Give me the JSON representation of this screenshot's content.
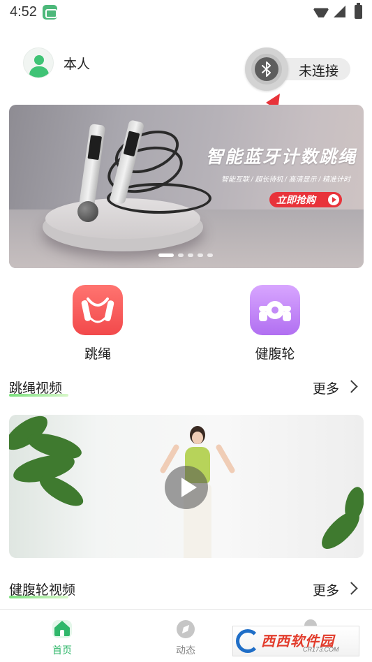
{
  "status_bar": {
    "time": "4:52",
    "icons": [
      "app-notification-icon",
      "wifi-icon",
      "cellular-signal-icon",
      "battery-charging-icon"
    ]
  },
  "header": {
    "user_name": "本人",
    "bluetooth_status": "未连接",
    "bluetooth_icon": "bluetooth-icon"
  },
  "banner": {
    "title": "智能蓝牙计数跳绳",
    "subtitle": "智能互联 / 超长待机 / 高清显示 / 精准计时",
    "cta_label": "立即抢购",
    "slide_count": 5,
    "active_slide": 1
  },
  "categories": [
    {
      "label": "跳绳",
      "icon": "jump-rope-icon",
      "color": "#f2494b"
    },
    {
      "label": "健腹轮",
      "icon": "ab-wheel-icon",
      "color": "#b16ff1"
    }
  ],
  "sections": [
    {
      "title": "跳绳视频",
      "more_label": "更多"
    },
    {
      "title": "健腹轮视频",
      "more_label": "更多"
    }
  ],
  "video": {
    "icon": "play-icon"
  },
  "bottom_nav": {
    "items": [
      {
        "label": "首页",
        "icon": "home-icon",
        "active": true
      },
      {
        "label": "动态",
        "icon": "compass-icon",
        "active": false
      },
      {
        "label": "",
        "icon": "profile-icon",
        "active": false
      }
    ]
  },
  "watermark": {
    "brand": "西西软件园",
    "url": "CR173.COM"
  },
  "colors": {
    "accent": "#2fb76a",
    "annotation_arrow": "#e8333a",
    "cta": "#e8333a"
  }
}
